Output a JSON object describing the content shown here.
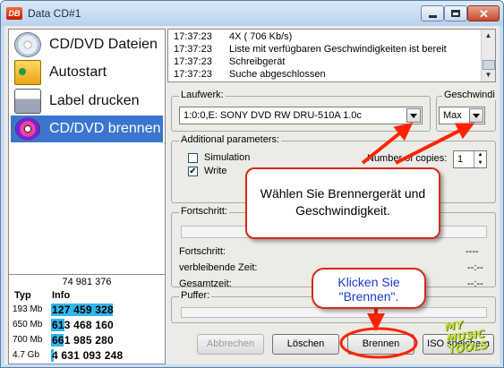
{
  "window": {
    "app_icon_text": "DB",
    "title": "Data CD#1"
  },
  "sidebar": {
    "items": [
      {
        "label": "CD/DVD Dateien",
        "icon": "cd-icon",
        "selected": false
      },
      {
        "label": "Autostart",
        "icon": "folder-autostart-icon",
        "selected": false
      },
      {
        "label": "Label drucken",
        "icon": "printer-icon",
        "selected": false
      },
      {
        "label": "CD/DVD brennen",
        "icon": "cd-burn-icon",
        "selected": true
      }
    ]
  },
  "stats": {
    "total": "74 981 376",
    "headers": {
      "type": "Typ",
      "info": "Info"
    },
    "rows": [
      {
        "type": "193 Mb",
        "value": "127 459 328",
        "fill": 0.55
      },
      {
        "type": "650 Mb",
        "value": "613 468 160",
        "fill": 0.12
      },
      {
        "type": "700 Mb",
        "value": "661 985 280",
        "fill": 0.11
      },
      {
        "type": "4.7 Gb",
        "value": "4 631 093 248",
        "fill": 0.02
      }
    ]
  },
  "log": {
    "lines": [
      {
        "time": "17:37:23",
        "msg": "4X ( 706 Kb/s)"
      },
      {
        "time": "17:37:23",
        "msg": "Liste mit verfügbaren Geschwindigkeiten ist bereit"
      },
      {
        "time": "17:37:23",
        "msg": "Schreibgerät"
      },
      {
        "time": "17:37:23",
        "msg": "Suche abgeschlossen"
      }
    ]
  },
  "drive": {
    "group_title": "Laufwerk:",
    "value": "1:0:0,E: SONY    DVD RW DRU-510A 1.0c"
  },
  "speed": {
    "group_title": "Geschwindi",
    "value": "Max"
  },
  "params": {
    "group_title": "Additional parameters:",
    "simulation": {
      "label": "Simulation",
      "checked": false
    },
    "write": {
      "label": "Write",
      "checked": true,
      "mark": "✔"
    },
    "copies_label": "Number of copies:",
    "copies_value": "1"
  },
  "progress": {
    "group_title": "Fortschritt:",
    "rows": [
      {
        "label": "Fortschritt:",
        "value": "----"
      },
      {
        "label": "verbleibende Zeit:",
        "value": "--:--"
      },
      {
        "label": "Gesamtzeit:",
        "value": "--:--"
      }
    ]
  },
  "buffer": {
    "group_title": "Puffer:"
  },
  "buttons": {
    "abort": "Abbrechen",
    "clear": "Löschen",
    "burn": "Brennen",
    "save_iso": "ISO speichern"
  },
  "callouts": {
    "drive_speed": "Wählen Sie Brennergerät und Geschwindigkeit.",
    "burn": "Klicken Sie \"Brennen\"."
  },
  "watermark": {
    "line1": "MY",
    "line2": "MUSIC",
    "line3": "TOOLS"
  },
  "colors": {
    "selection": "#3a76d0",
    "stat_bar": "#2fb6ee",
    "callout_border": "#d42a1a",
    "arrow": "#ff2200",
    "callout_text_blue": "#1a3ad4"
  }
}
